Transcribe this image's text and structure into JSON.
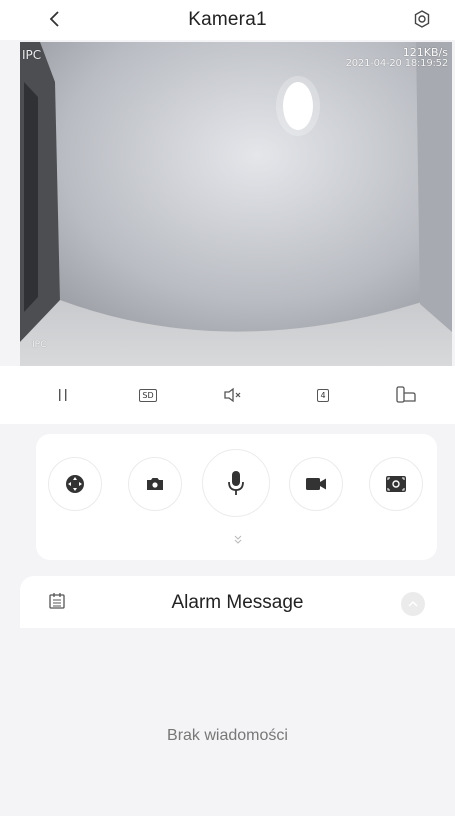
{
  "header": {
    "title": "Kamera1",
    "back_icon": "chevron-left-icon",
    "settings_icon": "gear-icon"
  },
  "video": {
    "osd_channel": "IPC",
    "osd_bitrate": "121KB/s",
    "osd_timestamp": "2021-04-20 18:19:52",
    "osd_camera_name": "IPC"
  },
  "control_bar": {
    "pause_icon": "pause-icon",
    "quality_label": "SD",
    "mute_icon": "speaker-muted-icon",
    "split_label": "4",
    "rotate_icon": "rotate-screen-icon"
  },
  "actions": {
    "items": [
      {
        "icon": "ptz-joystick-icon"
      },
      {
        "icon": "camera-snapshot-icon"
      },
      {
        "icon": "microphone-icon"
      },
      {
        "icon": "video-record-icon"
      },
      {
        "icon": "fullscreen-capture-icon"
      }
    ],
    "expand_icon": "double-chevron-down-icon"
  },
  "alarm": {
    "title": "Alarm Message",
    "calendar_icon": "calendar-icon",
    "collapse_icon": "chevron-up-icon",
    "empty_text": "Brak wiadomości"
  },
  "colors": {
    "background": "#f4f4f6",
    "card": "#ffffff",
    "icon_dark": "#333333",
    "muted_text": "#777777"
  }
}
